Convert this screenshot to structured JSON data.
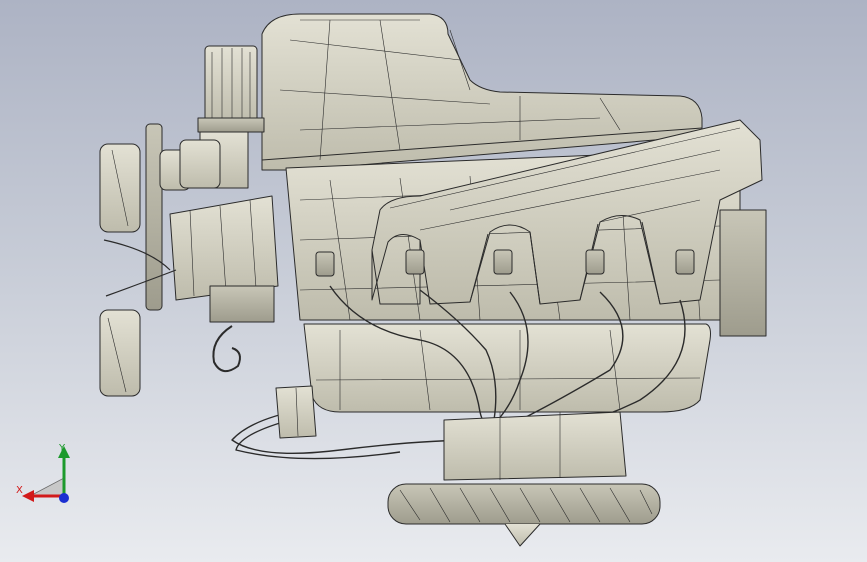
{
  "viewport": {
    "background_top": "#adb3c4",
    "background_bottom": "#e9ebef",
    "model_fill": "#d9d7c8",
    "model_fill_dark": "#b9b7a8",
    "edge_color": "#2b2b2b"
  },
  "triad": {
    "x_label": "X",
    "y_label": "Y",
    "x_color": "#d21a1a",
    "y_color": "#1c9a2c",
    "z_color": "#1b2fd1"
  }
}
